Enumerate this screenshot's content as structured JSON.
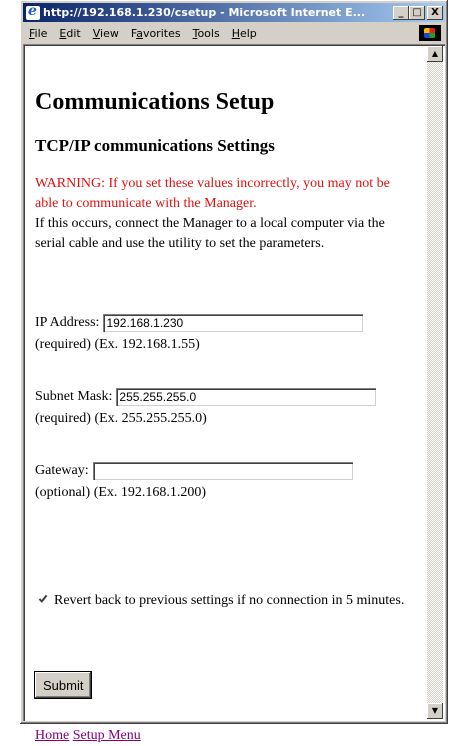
{
  "window": {
    "title": "http://192.168.1.230/csetup - Microsoft Internet E...",
    "minimize": "_",
    "maximize": "□",
    "close": "X"
  },
  "menubar": {
    "items": [
      {
        "hotkey": "F",
        "rest": "ile"
      },
      {
        "hotkey": "E",
        "rest": "dit"
      },
      {
        "hotkey": "V",
        "rest": "iew"
      },
      {
        "pre": "F",
        "hotkey": "a",
        "rest": "vorites"
      },
      {
        "hotkey": "T",
        "rest": "ools"
      },
      {
        "hotkey": "H",
        "rest": "elp"
      }
    ]
  },
  "page": {
    "title": "Communications Setup",
    "subtitle": "TCP/IP communications Settings",
    "warning": "WARNING: If you set these values incorrectly, you may not be able to communicate with the Manager.",
    "instructions": "If this occurs, connect the Manager to a local computer via the serial cable and use the utility to set the parameters."
  },
  "form": {
    "ip": {
      "label": "IP Address:",
      "value": "192.168.1.230",
      "hint": "(required) (Ex. 192.168.1.55)"
    },
    "subnet": {
      "label": "Subnet Mask:",
      "value": "255.255.255.0",
      "hint": "(required) (Ex. 255.255.255.0)"
    },
    "gateway": {
      "label": "Gateway:",
      "value": "",
      "hint": "(optional) (Ex. 192.168.1.200)"
    },
    "revert": {
      "label": "Revert back to previous settings if no connection in 5 minutes.",
      "checked": true
    },
    "submit_label": "Submit"
  },
  "links": {
    "home": "Home",
    "setup_menu": "Setup Menu"
  },
  "colors": {
    "warning": "#e01010",
    "visited_link": "#800080",
    "titlebar_start": "#0a246a",
    "titlebar_end": "#a6caf0"
  },
  "icons": {
    "title": "ie-page-icon",
    "throbber": "windows-logo-icon",
    "scroll_up": "scroll-up-arrow-icon",
    "scroll_down": "scroll-down-arrow-icon"
  }
}
